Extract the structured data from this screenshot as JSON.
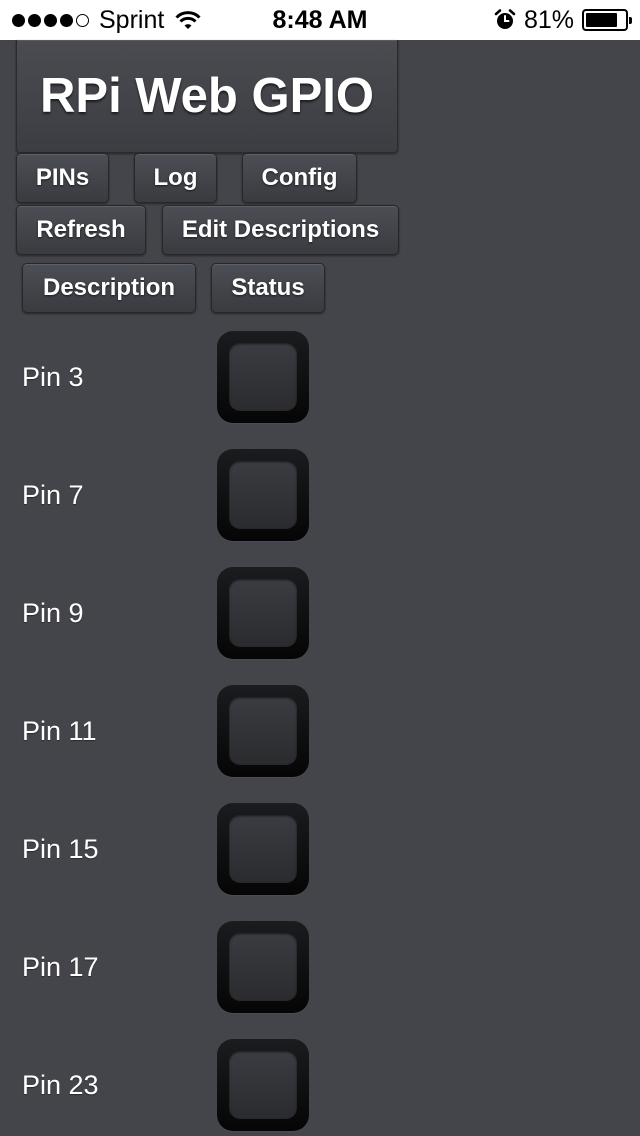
{
  "status_bar": {
    "carrier": "Sprint",
    "time": "8:48 AM",
    "battery_percent": "81%",
    "battery_level": 0.81,
    "signal_bars_filled": 4,
    "signal_bars_total": 5,
    "icons": [
      "signal-icon",
      "wifi-icon",
      "alarm-icon",
      "battery-icon"
    ]
  },
  "header": {
    "title": "RPi Web GPIO"
  },
  "nav": {
    "pins_label": "PINs",
    "log_label": "Log",
    "config_label": "Config",
    "refresh_label": "Refresh",
    "edit_descriptions_label": "Edit Descriptions"
  },
  "table": {
    "col_description": "Description",
    "col_status": "Status"
  },
  "pins": [
    {
      "label": "Pin 3",
      "checked": false
    },
    {
      "label": "Pin 7",
      "checked": false
    },
    {
      "label": "Pin 9",
      "checked": false
    },
    {
      "label": "Pin 11",
      "checked": false
    },
    {
      "label": "Pin 15",
      "checked": false
    },
    {
      "label": "Pin 17",
      "checked": false
    },
    {
      "label": "Pin 23",
      "checked": false
    }
  ],
  "colors": {
    "background": "#44454a",
    "button_top": "#4c4e55",
    "button_bottom": "#393b40",
    "text": "#ffffff"
  }
}
